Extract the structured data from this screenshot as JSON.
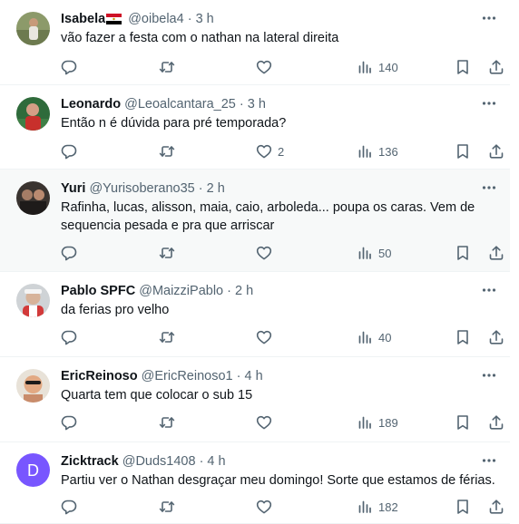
{
  "tweets": [
    {
      "name": "Isabela",
      "handle": "@oibela4",
      "time": "· 3 h",
      "text": "vão fazer a festa com o nathan na lateral direita",
      "replies": "",
      "likes": "",
      "views": "140",
      "has_flag": true,
      "avatar_type": "photo"
    },
    {
      "name": "Leonardo",
      "handle": "@Leoalcantara_25",
      "time": "· 3 h",
      "text": "Então n é dúvida para pré temporada?",
      "replies": "",
      "likes": "2",
      "views": "136",
      "avatar_type": "photo"
    },
    {
      "name": "Yuri",
      "handle": "@Yurisoberano35",
      "time": "· 2 h",
      "text": "Rafinha, lucas, alisson, maia, caio, arboleda... poupa os caras. Vem de sequencia pesada e pra que arriscar",
      "replies": "",
      "likes": "",
      "views": "50",
      "highlighted": true,
      "avatar_type": "photo"
    },
    {
      "name": "Pablo SPFC",
      "handle": "@MaizziPablo",
      "time": "· 2 h",
      "text": "da ferias pro velho",
      "replies": "",
      "likes": "",
      "views": "40",
      "avatar_type": "photo"
    },
    {
      "name": "EricReinoso",
      "handle": "@EricReinoso1",
      "time": "· 4 h",
      "text": "Quarta tem que colocar o sub 15",
      "replies": "",
      "likes": "",
      "views": "189",
      "avatar_type": "photo"
    },
    {
      "name": "Zicktrack",
      "handle": "@Duds1408",
      "time": "· 4 h",
      "text": "Partiu ver o Nathan desgraçar meu domingo! Sorte que estamos de férias.",
      "replies": "",
      "likes": "",
      "views": "182",
      "avatar_type": "letter",
      "avatar_letter": "D",
      "avatar_color": "#7856ff"
    }
  ],
  "icons": [
    "reply-icon",
    "retweet-icon",
    "like-icon",
    "views-icon",
    "bookmark-icon",
    "share-icon",
    "more-options-icon"
  ],
  "colors": {
    "text": "#0f1419",
    "secondary": "#536471",
    "divider": "#eff3f4",
    "hover_bg": "#f7f9f9"
  }
}
